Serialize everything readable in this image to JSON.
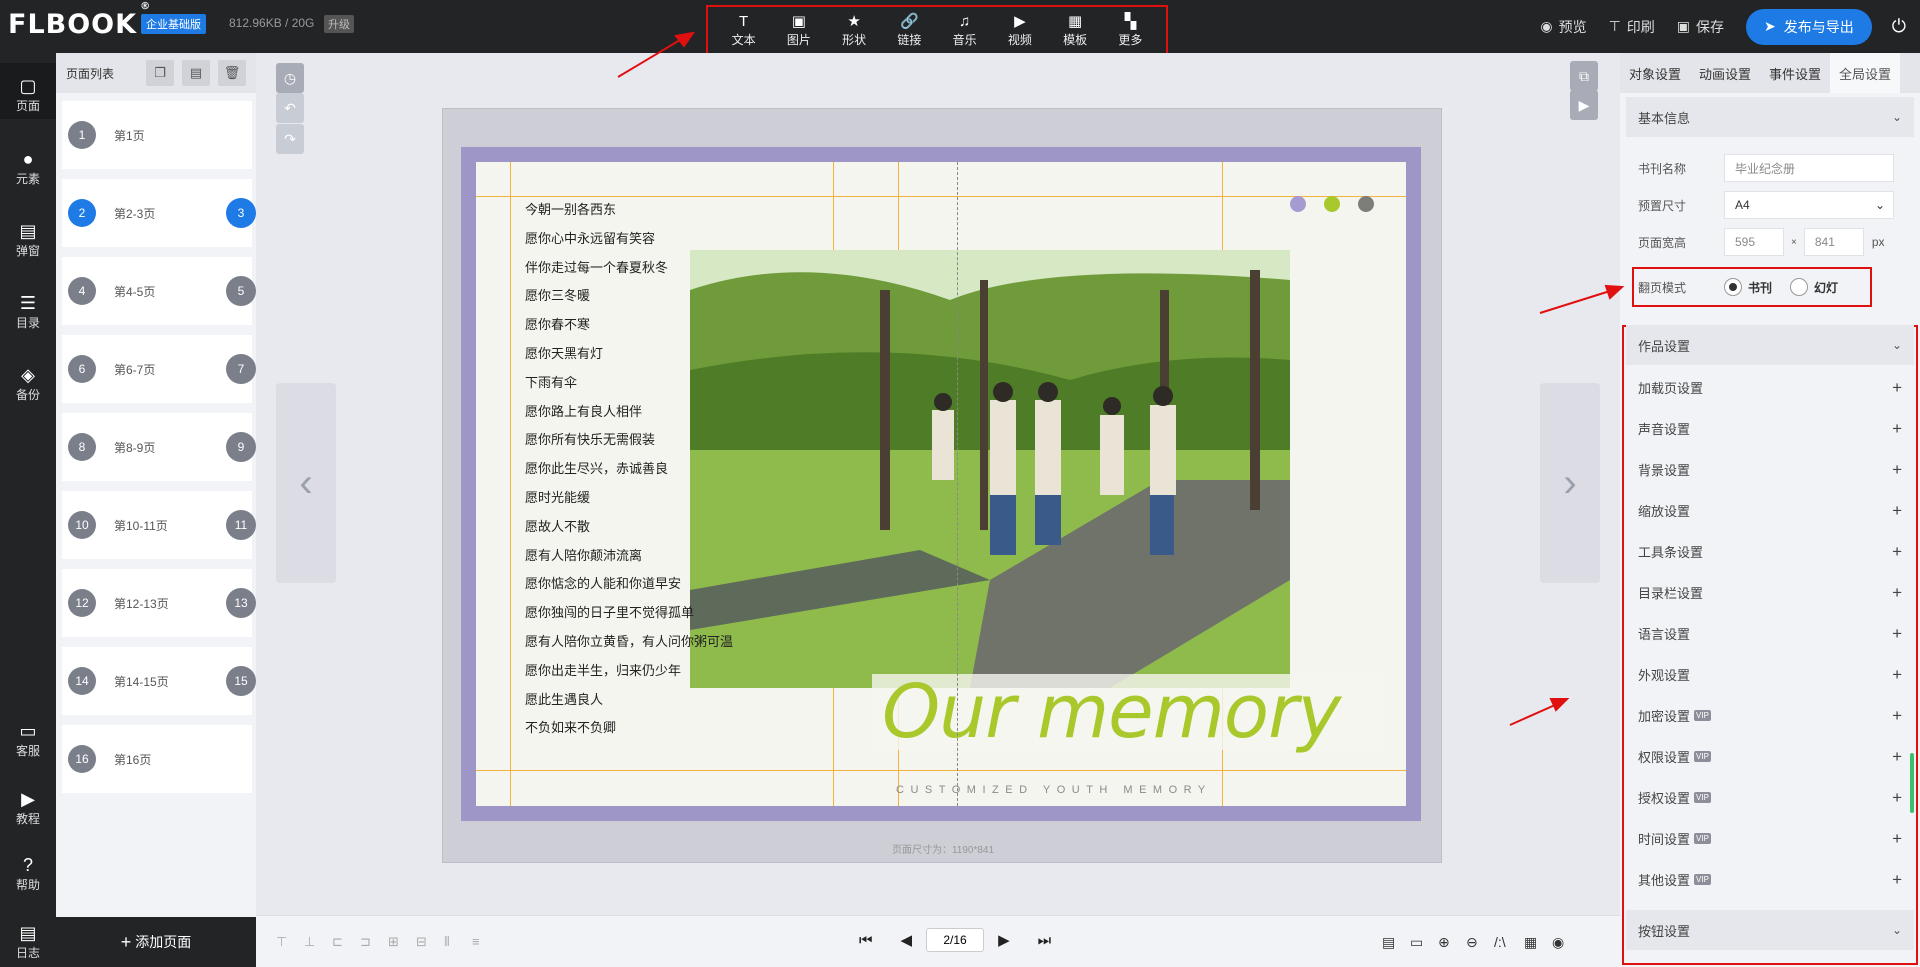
{
  "topbar": {
    "logo": "FLBOOK",
    "logo_reg": "®",
    "edition": "企业基础版",
    "storage": "812.96KB / 20G",
    "upgrade": "升级",
    "tools": [
      {
        "icon": "text-icon",
        "glyph": "T",
        "label": "文本"
      },
      {
        "icon": "image-icon",
        "glyph": "▣",
        "label": "图片"
      },
      {
        "icon": "star-icon",
        "glyph": "★",
        "label": "形状"
      },
      {
        "icon": "link-icon",
        "glyph": "🔗",
        "label": "链接"
      },
      {
        "icon": "music-icon",
        "glyph": "♫",
        "label": "音乐"
      },
      {
        "icon": "video-icon",
        "glyph": "▶",
        "label": "视频"
      },
      {
        "icon": "template-icon",
        "glyph": "▦",
        "label": "模板"
      },
      {
        "icon": "more-icon",
        "glyph": "▚",
        "label": "更多"
      }
    ],
    "preview": "预览",
    "print": "印刷",
    "save": "保存",
    "publish": "发布与导出"
  },
  "leftnav": [
    {
      "icon": "page-icon",
      "glyph": "▢",
      "label": "页面"
    },
    {
      "icon": "element-icon",
      "glyph": "●",
      "label": "元素"
    },
    {
      "icon": "popup-icon",
      "glyph": "▤",
      "label": "弹窗"
    },
    {
      "icon": "toc-icon",
      "glyph": "☰",
      "label": "目录"
    },
    {
      "icon": "backup-icon",
      "glyph": "◈",
      "label": "备份"
    },
    {
      "icon": "service-icon",
      "glyph": "▭",
      "label": "客服"
    },
    {
      "icon": "tutorial-icon",
      "glyph": "▶",
      "label": "教程"
    },
    {
      "icon": "help-icon",
      "glyph": "?",
      "label": "帮助"
    },
    {
      "icon": "log-icon",
      "glyph": "▤",
      "label": "日志"
    }
  ],
  "pagelist": {
    "title": "页面列表",
    "pages": [
      {
        "n1": "1",
        "label": "第1页",
        "n2": ""
      },
      {
        "n1": "2",
        "label": "第2-3页",
        "n2": "3"
      },
      {
        "n1": "4",
        "label": "第4-5页",
        "n2": "5"
      },
      {
        "n1": "6",
        "label": "第6-7页",
        "n2": "7"
      },
      {
        "n1": "8",
        "label": "第8-9页",
        "n2": "9"
      },
      {
        "n1": "10",
        "label": "第10-11页",
        "n2": "11"
      },
      {
        "n1": "12",
        "label": "第12-13页",
        "n2": "13"
      },
      {
        "n1": "14",
        "label": "第14-15页",
        "n2": "15"
      },
      {
        "n1": "16",
        "label": "第16页",
        "n2": ""
      }
    ],
    "add_page": "添加页面"
  },
  "canvas": {
    "poem": [
      "今朝一别各西东",
      "愿你心中永远留有笑容",
      "伴你走过每一个春夏秋冬",
      "愿你三冬暖",
      "愿你春不寒",
      "愿你天黑有灯",
      "下雨有伞",
      "愿你路上有良人相伴",
      "愿你所有快乐无需假装",
      "愿你此生尽兴，赤诚善良",
      "愿时光能缓",
      "愿故人不散",
      "愿有人陪你颠沛流离",
      "愿你惦念的人能和你道早安",
      "愿你独闯的日子里不觉得孤单",
      "愿有人陪你立黄昏，有人问你粥可温",
      "愿你出走半生，归来仍少年",
      "愿此生遇良人",
      "不负如来不负卿"
    ],
    "dot_colors": [
      "#a69bd0",
      "#a9c82c",
      "#7d7d7a"
    ],
    "title": "Our memory",
    "subtitle": "CUSTOMIZED YOUTH MEMORY",
    "page_size": "页面尺寸为：1190*841"
  },
  "pager": {
    "current": "2/16"
  },
  "rightpanel": {
    "tabs": [
      "对象设置",
      "动画设置",
      "事件设置",
      "全局设置"
    ],
    "basic": {
      "title": "基本信息",
      "book_name_label": "书刊名称",
      "book_name_placeholder": "毕业纪念册",
      "size_label": "预置尺寸",
      "size_value": "A4",
      "wh_label": "页面宽高",
      "width": "595",
      "times": "×",
      "height": "841",
      "unit": "px",
      "flip_label": "翻页模式",
      "flip_book": "书刊",
      "flip_slide": "幻灯"
    },
    "work": {
      "title": "作品设置",
      "items": [
        {
          "label": "加载页设置",
          "vip": ""
        },
        {
          "label": "声音设置",
          "vip": ""
        },
        {
          "label": "背景设置",
          "vip": ""
        },
        {
          "label": "缩放设置",
          "vip": ""
        },
        {
          "label": "工具条设置",
          "vip": ""
        },
        {
          "label": "目录栏设置",
          "vip": ""
        },
        {
          "label": "语言设置",
          "vip": ""
        },
        {
          "label": "外观设置",
          "vip": ""
        },
        {
          "label": "加密设置",
          "vip": "VIP"
        },
        {
          "label": "权限设置",
          "vip": "VIP"
        },
        {
          "label": "授权设置",
          "vip": "VIP"
        },
        {
          "label": "时间设置",
          "vip": "VIP"
        },
        {
          "label": "其他设置",
          "vip": "VIP"
        }
      ]
    },
    "button_settings": "按钮设置"
  }
}
